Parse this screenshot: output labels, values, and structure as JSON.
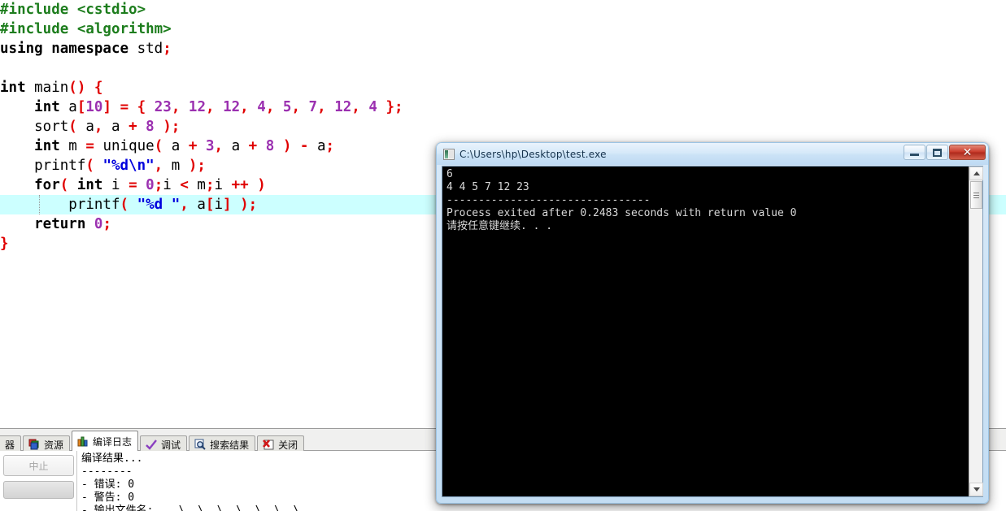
{
  "editor": {
    "lines": [
      {
        "highlighted": false,
        "tokens": [
          {
            "t": "pre",
            "s": "#include <cstdio>"
          }
        ]
      },
      {
        "highlighted": false,
        "tokens": [
          {
            "t": "pre",
            "s": "#include <algorithm>"
          }
        ]
      },
      {
        "highlighted": false,
        "tokens": [
          {
            "t": "kw",
            "s": "using namespace"
          },
          {
            "t": "id",
            "s": " std"
          },
          {
            "t": "punc",
            "s": ";"
          }
        ]
      },
      {
        "highlighted": false,
        "tokens": [
          {
            "t": "id",
            "s": ""
          }
        ]
      },
      {
        "highlighted": false,
        "tokens": [
          {
            "t": "kw",
            "s": "int"
          },
          {
            "t": "id",
            "s": " main"
          },
          {
            "t": "punc",
            "s": "() {"
          }
        ]
      },
      {
        "highlighted": false,
        "tokens": [
          {
            "t": "id",
            "s": "    "
          },
          {
            "t": "kw",
            "s": "int"
          },
          {
            "t": "id",
            "s": " a"
          },
          {
            "t": "punc",
            "s": "["
          },
          {
            "t": "num",
            "s": "10"
          },
          {
            "t": "punc",
            "s": "]"
          },
          {
            "t": "id",
            "s": " "
          },
          {
            "t": "op",
            "s": "="
          },
          {
            "t": "id",
            "s": " "
          },
          {
            "t": "punc",
            "s": "{"
          },
          {
            "t": "id",
            "s": " "
          },
          {
            "t": "num",
            "s": "23"
          },
          {
            "t": "punc",
            "s": ","
          },
          {
            "t": "id",
            "s": " "
          },
          {
            "t": "num",
            "s": "12"
          },
          {
            "t": "punc",
            "s": ","
          },
          {
            "t": "id",
            "s": " "
          },
          {
            "t": "num",
            "s": "12"
          },
          {
            "t": "punc",
            "s": ","
          },
          {
            "t": "id",
            "s": " "
          },
          {
            "t": "num",
            "s": "4"
          },
          {
            "t": "punc",
            "s": ","
          },
          {
            "t": "id",
            "s": " "
          },
          {
            "t": "num",
            "s": "5"
          },
          {
            "t": "punc",
            "s": ","
          },
          {
            "t": "id",
            "s": " "
          },
          {
            "t": "num",
            "s": "7"
          },
          {
            "t": "punc",
            "s": ","
          },
          {
            "t": "id",
            "s": " "
          },
          {
            "t": "num",
            "s": "12"
          },
          {
            "t": "punc",
            "s": ","
          },
          {
            "t": "id",
            "s": " "
          },
          {
            "t": "num",
            "s": "4"
          },
          {
            "t": "id",
            "s": " "
          },
          {
            "t": "punc",
            "s": "};"
          }
        ]
      },
      {
        "highlighted": false,
        "tokens": [
          {
            "t": "id",
            "s": "    sort"
          },
          {
            "t": "punc",
            "s": "("
          },
          {
            "t": "id",
            "s": " a"
          },
          {
            "t": "punc",
            "s": ","
          },
          {
            "t": "id",
            "s": " a "
          },
          {
            "t": "op",
            "s": "+"
          },
          {
            "t": "id",
            "s": " "
          },
          {
            "t": "num",
            "s": "8"
          },
          {
            "t": "id",
            "s": " "
          },
          {
            "t": "punc",
            "s": ");"
          }
        ]
      },
      {
        "highlighted": false,
        "tokens": [
          {
            "t": "id",
            "s": "    "
          },
          {
            "t": "kw",
            "s": "int"
          },
          {
            "t": "id",
            "s": " m "
          },
          {
            "t": "op",
            "s": "="
          },
          {
            "t": "id",
            "s": " unique"
          },
          {
            "t": "punc",
            "s": "("
          },
          {
            "t": "id",
            "s": " a "
          },
          {
            "t": "op",
            "s": "+"
          },
          {
            "t": "id",
            "s": " "
          },
          {
            "t": "num",
            "s": "3"
          },
          {
            "t": "punc",
            "s": ","
          },
          {
            "t": "id",
            "s": " a "
          },
          {
            "t": "op",
            "s": "+"
          },
          {
            "t": "id",
            "s": " "
          },
          {
            "t": "num",
            "s": "8"
          },
          {
            "t": "id",
            "s": " "
          },
          {
            "t": "punc",
            "s": ")"
          },
          {
            "t": "id",
            "s": " "
          },
          {
            "t": "op",
            "s": "-"
          },
          {
            "t": "id",
            "s": " a"
          },
          {
            "t": "punc",
            "s": ";"
          }
        ]
      },
      {
        "highlighted": false,
        "tokens": [
          {
            "t": "id",
            "s": "    printf"
          },
          {
            "t": "punc",
            "s": "("
          },
          {
            "t": "id",
            "s": " "
          },
          {
            "t": "str",
            "s": "\"%d\\n\""
          },
          {
            "t": "punc",
            "s": ","
          },
          {
            "t": "id",
            "s": " m "
          },
          {
            "t": "punc",
            "s": ");"
          }
        ]
      },
      {
        "highlighted": false,
        "tokens": [
          {
            "t": "kw",
            "s": "    for"
          },
          {
            "t": "punc",
            "s": "("
          },
          {
            "t": "id",
            "s": " "
          },
          {
            "t": "kw",
            "s": "int"
          },
          {
            "t": "id",
            "s": " i "
          },
          {
            "t": "op",
            "s": "="
          },
          {
            "t": "id",
            "s": " "
          },
          {
            "t": "num",
            "s": "0"
          },
          {
            "t": "punc",
            "s": ";"
          },
          {
            "t": "id",
            "s": "i "
          },
          {
            "t": "op",
            "s": "<"
          },
          {
            "t": "id",
            "s": " m"
          },
          {
            "t": "punc",
            "s": ";"
          },
          {
            "t": "id",
            "s": "i "
          },
          {
            "t": "op",
            "s": "++"
          },
          {
            "t": "id",
            "s": " "
          },
          {
            "t": "punc",
            "s": ")"
          }
        ]
      },
      {
        "highlighted": true,
        "tokens": [
          {
            "t": "id",
            "s": "        printf"
          },
          {
            "t": "punc",
            "s": "("
          },
          {
            "t": "id",
            "s": " "
          },
          {
            "t": "str",
            "s": "\"%d \""
          },
          {
            "t": "punc",
            "s": ","
          },
          {
            "t": "id",
            "s": " a"
          },
          {
            "t": "punc",
            "s": "["
          },
          {
            "t": "id",
            "s": "i"
          },
          {
            "t": "punc",
            "s": "]"
          },
          {
            "t": "id",
            "s": " "
          },
          {
            "t": "punc",
            "s": ");"
          }
        ]
      },
      {
        "highlighted": false,
        "tokens": [
          {
            "t": "kw",
            "s": "    return"
          },
          {
            "t": "id",
            "s": " "
          },
          {
            "t": "num",
            "s": "0"
          },
          {
            "t": "punc",
            "s": ";"
          }
        ]
      },
      {
        "highlighted": false,
        "tokens": [
          {
            "t": "punc",
            "s": "}"
          }
        ]
      }
    ]
  },
  "bottom_panel": {
    "tabs": [
      {
        "label": "器",
        "icon": "cut-off-tab-icon",
        "active": false
      },
      {
        "label": "资源",
        "icon": "resources-icon",
        "active": false
      },
      {
        "label": "编译日志",
        "icon": "bar-chart-icon",
        "active": true
      },
      {
        "label": "调试",
        "icon": "check-icon",
        "active": false
      },
      {
        "label": "搜索结果",
        "icon": "magnifier-icon",
        "active": false
      },
      {
        "label": "关闭",
        "icon": "close-x-icon",
        "active": false
      }
    ],
    "abort_button": "中止",
    "progress_value": 0,
    "log_lines": [
      "编译结果...",
      "--------",
      "- 错误: 0",
      "- 警告: 0",
      "- 输出文件名:  ..\\..\\..\\..\\..\\..\\..\\"
    ]
  },
  "console_window": {
    "title": "C:\\Users\\hp\\Desktop\\test.exe",
    "icon": "console-app-icon",
    "buttons": {
      "minimize": "minimize-button",
      "maximize": "maximize-button",
      "close": "close-button"
    },
    "output_lines": [
      "6",
      "4 4 5 7 12 23",
      "--------------------------------",
      "Process exited after 0.2483 seconds with return value 0",
      "请按任意键继续. . ."
    ],
    "scrollbar": {
      "position": "top"
    }
  },
  "colors": {
    "highlight_line": "#CCFFFF",
    "keyword": "#000000",
    "preprocessor": "#1d7d1d",
    "number": "#9b30b0",
    "string": "#0000dd",
    "punctuation": "#e00000",
    "console_bg": "#000000",
    "console_fg": "#d8d8d8",
    "titlebar": "#cbe2f6",
    "close_button": "#c9392a"
  }
}
